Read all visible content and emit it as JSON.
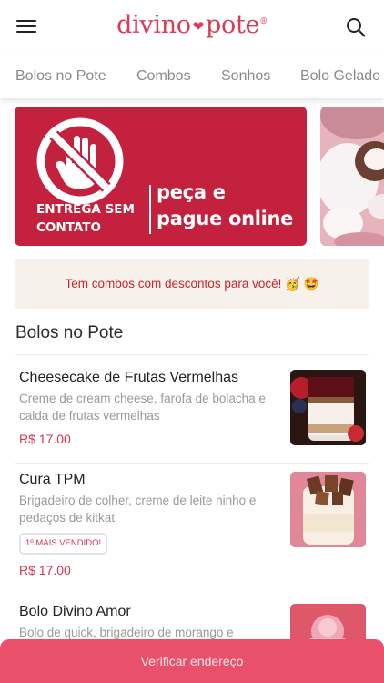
{
  "header": {
    "logo_left": "divino",
    "logo_right": "pote",
    "logo_mark": "®",
    "menu_icon": "hamburger-menu-icon",
    "search_icon": "search-icon"
  },
  "tabs": [
    "Bolos no Pote",
    "Combos",
    "Sonhos",
    "Bolo Gelado"
  ],
  "banners": [
    {
      "left_line1": "ENTREGA SEM",
      "left_line2": "CONTATO",
      "right_line1": "peça e",
      "right_line2": "pague online",
      "icon": "no-touch-hand-icon",
      "color": "#c4213e"
    },
    {
      "image": "cake-photo"
    }
  ],
  "promo": {
    "text": "Tem combos com descontos para você! 🥳 🤩"
  },
  "section": {
    "title": "Bolos no Pote"
  },
  "products": [
    {
      "name": "Cheesecake de Frutas Vermelhas",
      "description": "Creme de cream cheese, farofa de bolacha e calda de frutas vermelhas",
      "price": "R$ 17.00",
      "badge": ""
    },
    {
      "name": "Cura TPM",
      "description": "Brigadeiro de colher, creme de leite ninho e pedaços de kitkat",
      "price": "R$ 17.00",
      "badge": "1º MAIS VENDIDO!"
    },
    {
      "name": "Bolo Divino Amor",
      "description": "Bolo de quick, brigadeiro de morango e",
      "price": "",
      "badge": ""
    }
  ],
  "bottom_bar": {
    "label": "Verificar endereço"
  },
  "colors": {
    "brand": "#d83d55",
    "banner": "#c4213e",
    "price": "#d9344f",
    "bottom_bar": "#e8506b",
    "promo_bg": "#f6f1ea"
  }
}
